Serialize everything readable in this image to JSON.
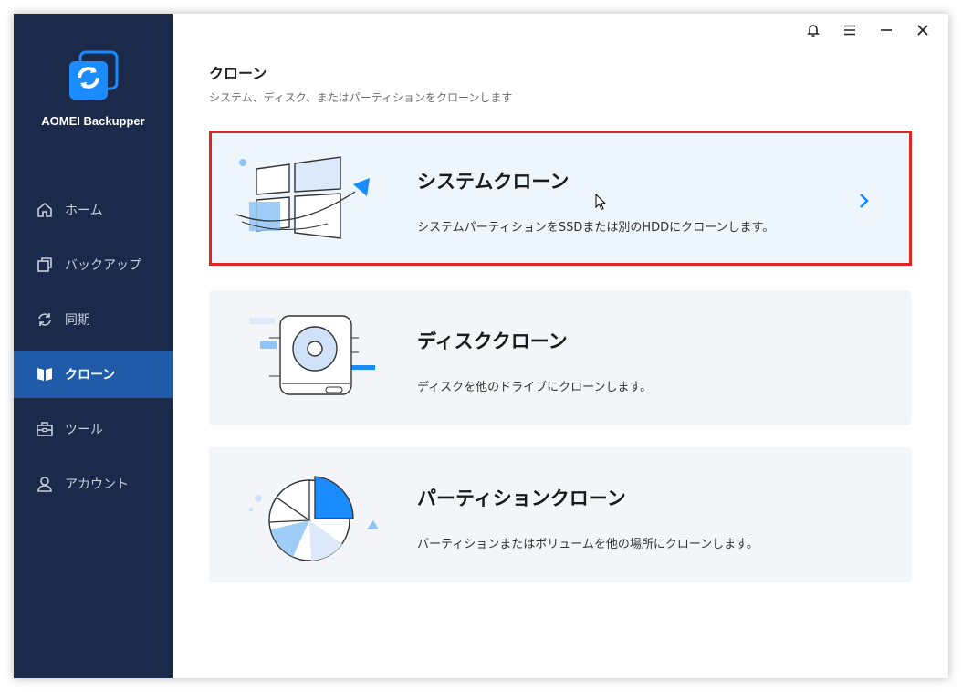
{
  "app": {
    "name": "AOMEI Backupper"
  },
  "sidebar": {
    "items": [
      {
        "label": "ホーム",
        "icon": "home-icon"
      },
      {
        "label": "バックアップ",
        "icon": "backup-icon"
      },
      {
        "label": "同期",
        "icon": "sync-icon"
      },
      {
        "label": "クローン",
        "icon": "clone-icon",
        "active": true
      },
      {
        "label": "ツール",
        "icon": "tools-icon"
      },
      {
        "label": "アカウント",
        "icon": "account-icon"
      }
    ]
  },
  "header": {
    "title": "クローン",
    "subtitle": "システム、ディスク、またはパーティションをクローンします"
  },
  "cards": [
    {
      "title": "システムクローン",
      "desc": "システムパーティションをSSDまたは別のHDDにクローンします。",
      "icon": "system-clone-illustration",
      "selected": true
    },
    {
      "title": "ディスククローン",
      "desc": "ディスクを他のドライブにクローンします。",
      "icon": "disk-clone-illustration"
    },
    {
      "title": "パーティションクローン",
      "desc": "パーティションまたはボリュームを他の場所にクローンします。",
      "icon": "partition-clone-illustration"
    }
  ],
  "colors": {
    "sidebar_bg": "#1b2a4a",
    "active_nav": "#1f5ba8",
    "accent": "#1a8cff",
    "highlight_border": "#e02424"
  }
}
